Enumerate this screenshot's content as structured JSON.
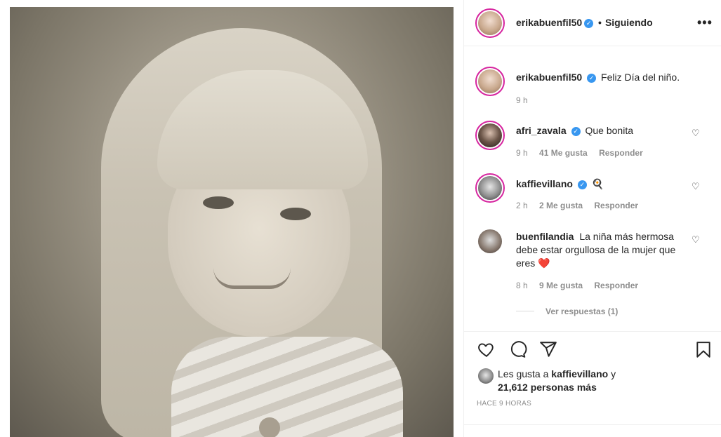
{
  "post": {
    "image_alt": "Fotografía antigua en blanco y negro de una niña con flequillo"
  },
  "header": {
    "username": "erikabuenfil50",
    "separator": "•",
    "follow_status": "Siguiendo",
    "more_icon": "more-horizontal-icon"
  },
  "caption": {
    "username": "erikabuenfil50",
    "text": "Feliz Día del niño.",
    "time": "9 h"
  },
  "comments": [
    {
      "username": "afri_zavala",
      "verified": true,
      "text": "Que bonita",
      "time": "9 h",
      "likes": "41 Me gusta",
      "reply": "Responder"
    },
    {
      "username": "kaffievillano",
      "verified": true,
      "text": "🍳",
      "time": "2 h",
      "likes": "2 Me gusta",
      "reply": "Responder"
    },
    {
      "username": "buenfilandia",
      "verified": false,
      "text": "La niña más hermosa debe estar orgullosa de la mujer que eres ❤️",
      "time": "8 h",
      "likes": "9 Me gusta",
      "reply": "Responder",
      "view_replies": "Ver respuestas (1)"
    }
  ],
  "actions": {
    "like_icon": "heart-icon",
    "comment_icon": "comment-icon",
    "share_icon": "share-icon",
    "save_icon": "bookmark-icon"
  },
  "likes": {
    "prefix": "Les gusta a",
    "user": "kaffievillano",
    "middle": "y",
    "count": "21,612 personas más"
  },
  "timestamp": "HACE 9 HORAS",
  "colors": {
    "verified": "#3897f0",
    "story_ring": "#d6249f",
    "heart_red": "#ed4956"
  }
}
